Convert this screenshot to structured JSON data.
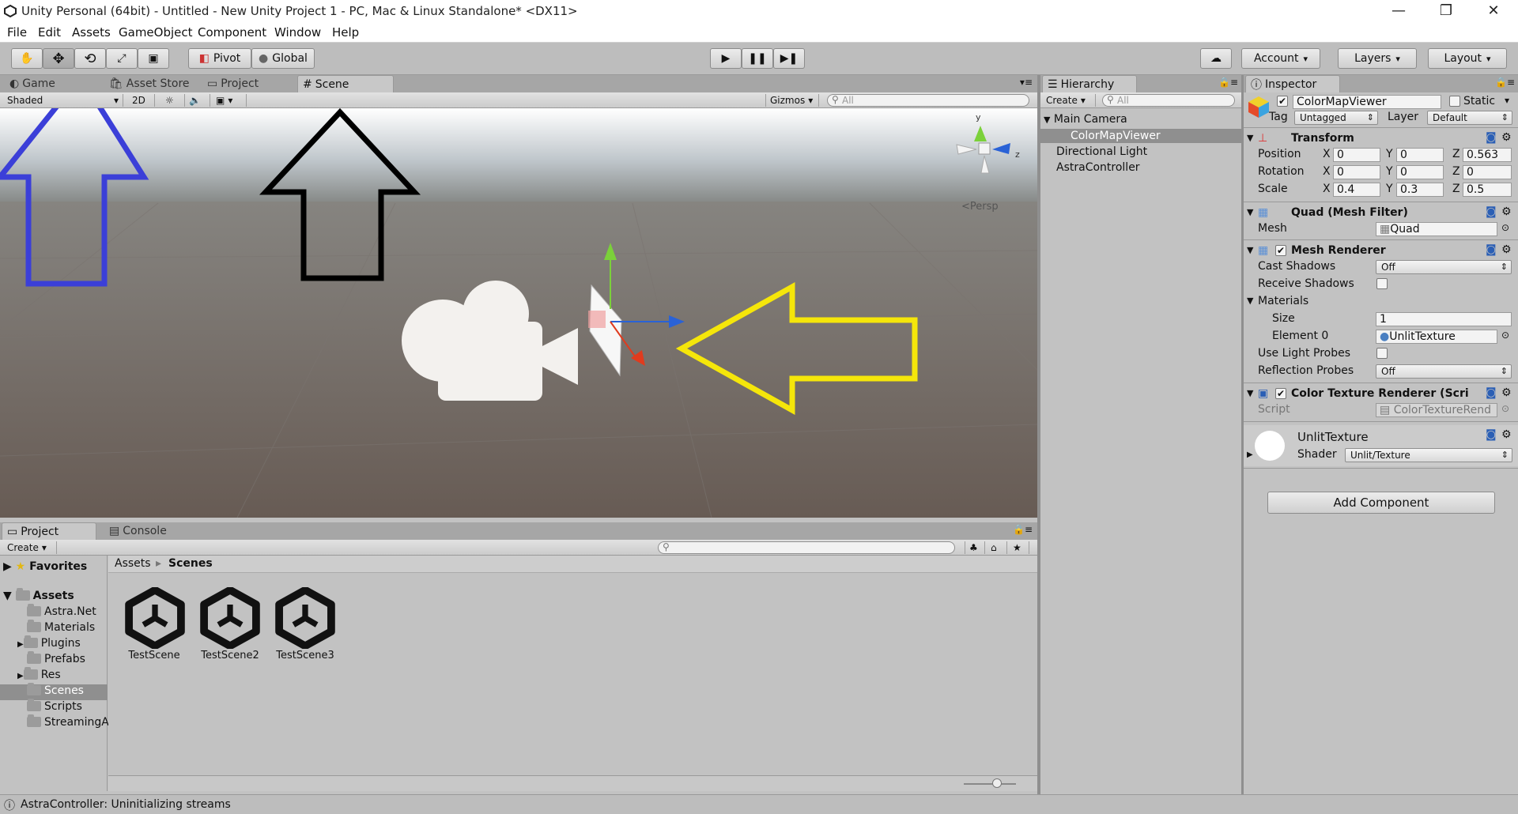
{
  "window": {
    "title": "Unity Personal (64bit) - Untitled - New Unity Project 1 - PC, Mac & Linux Standalone* <DX11>",
    "minimize": "—",
    "restore": "❐",
    "close": "✕"
  },
  "menu": [
    "File",
    "Edit",
    "Assets",
    "GameObject",
    "Component",
    "Window",
    "Help"
  ],
  "toolbar": {
    "tools": [
      "hand-tool",
      "move-tool",
      "rotate-tool",
      "scale-tool",
      "rect-tool"
    ],
    "pivot_label": "Pivot",
    "global_label": "Global",
    "account_label": "Account",
    "layers_label": "Layers",
    "layout_label": "Layout"
  },
  "scene_panel": {
    "tabs": [
      {
        "label": "Game",
        "icon": "game-icon"
      },
      {
        "label": "Asset Store",
        "icon": "store-icon"
      },
      {
        "label": "Project",
        "icon": "project-icon"
      },
      {
        "label": "Scene",
        "icon": "grid-icon",
        "active": true
      }
    ],
    "shading_mode": "Shaded",
    "mode_2d": "2D",
    "gizmos_label": "Gizmos",
    "search_placeholder": "All",
    "persp_label": "Persp",
    "gizmo_axes": {
      "y": "y",
      "z": "z"
    },
    "arrow_colors": {
      "blue": "#3b3fd8",
      "black": "#000000",
      "yellow": "#f5e60a"
    }
  },
  "hierarchy": {
    "tab_label": "Hierarchy",
    "create_label": "Create",
    "search_placeholder": "All",
    "items": [
      {
        "label": "Main Camera",
        "level": 0,
        "expanded": true
      },
      {
        "label": "ColorMapViewer",
        "level": 1,
        "selected": true
      },
      {
        "label": "Directional Light",
        "level": 0
      },
      {
        "label": "AstraController",
        "level": 0
      }
    ]
  },
  "inspector": {
    "tab_label": "Inspector",
    "object_name": "ColorMapViewer",
    "static_label": "Static",
    "tag_label": "Tag",
    "tag_value": "Untagged",
    "layer_label": "Layer",
    "layer_value": "Default",
    "transform": {
      "title": "Transform",
      "rows": [
        {
          "label": "Position",
          "x": "0",
          "y": "0",
          "z": "0.563"
        },
        {
          "label": "Rotation",
          "x": "0",
          "y": "0",
          "z": "0"
        },
        {
          "label": "Scale",
          "x": "0.4",
          "y": "0.3",
          "z": "0.5"
        }
      ],
      "axis_x": "X",
      "axis_y": "Y",
      "axis_z": "Z"
    },
    "mesh_filter": {
      "title": "Quad (Mesh Filter)",
      "mesh_label": "Mesh",
      "mesh_value": "Quad"
    },
    "mesh_renderer": {
      "title": "Mesh Renderer",
      "cast_shadows_label": "Cast Shadows",
      "cast_shadows_value": "Off",
      "receive_shadows_label": "Receive Shadows",
      "materials_label": "Materials",
      "size_label": "Size",
      "size_value": "1",
      "element0_label": "Element 0",
      "element0_value": "UnlitTexture",
      "light_probes_label": "Use Light Probes",
      "reflection_probes_label": "Reflection Probes",
      "reflection_probes_value": "Off"
    },
    "script_component": {
      "title": "Color Texture Renderer (Scri",
      "script_label": "Script",
      "script_value": "ColorTextureRend"
    },
    "material": {
      "name": "UnlitTexture",
      "shader_label": "Shader",
      "shader_value": "Unlit/Texture"
    },
    "add_component_label": "Add Component"
  },
  "project_panel": {
    "tabs": [
      {
        "label": "Project",
        "icon": "project-icon",
        "active": true
      },
      {
        "label": "Console",
        "icon": "console-icon"
      }
    ],
    "create_label": "Create",
    "favorites_label": "Favorites",
    "assets_label": "Assets",
    "folders": [
      "Astra.Net",
      "Materials",
      "Plugins",
      "Prefabs",
      "Res",
      "Scenes",
      "Scripts",
      "StreamingA"
    ],
    "folders_with_children": [
      "Plugins",
      "Res"
    ],
    "selected_folder": "Scenes",
    "breadcrumb": [
      "Assets",
      "Scenes"
    ],
    "assets": [
      "TestScene",
      "TestScene2",
      "TestScene3"
    ]
  },
  "status_bar": {
    "message": "AstraController: Uninitializing streams"
  }
}
